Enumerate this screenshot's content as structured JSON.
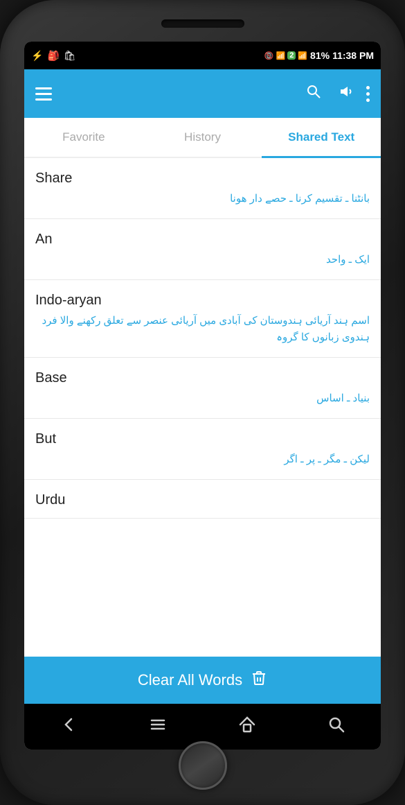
{
  "status_bar": {
    "time": "11:38 PM",
    "battery": "81%",
    "icons_left": [
      "⚡",
      "🎒",
      "🛍"
    ]
  },
  "top_bar": {
    "menu_icon": "☰",
    "search_icon": "🔍",
    "volume_icon": "🔊",
    "more_icon": "⋮"
  },
  "tabs": [
    {
      "id": "favorite",
      "label": "Favorite",
      "active": false
    },
    {
      "id": "history",
      "label": "History",
      "active": false
    },
    {
      "id": "shared-text",
      "label": "Shared Text",
      "active": true
    }
  ],
  "words": [
    {
      "english": "Share",
      "urdu": "بانٹنا ـ تقسیم کرنا ـ حصے دار ھونا"
    },
    {
      "english": "An",
      "urdu": "ایک ـ واحد"
    },
    {
      "english": "Indo-aryan",
      "urdu": "اسم  ہند آریائی ہندوستان کی آبادی میں آریائی عنصر سے تعلق رکھنے والا فرد  ہندوی زبانوں کا گروہ"
    },
    {
      "english": "Base",
      "urdu": "بنیاد ـ اساس"
    },
    {
      "english": "But",
      "urdu": "لیکن ـ مگر ـ پر ـ اگر"
    },
    {
      "english": "Urdu",
      "urdu": ""
    }
  ],
  "clear_button": {
    "label": "Clear All Words",
    "icon": "🗑"
  },
  "bottom_nav": {
    "back_icon": "←",
    "menu_icon": "≡",
    "home_icon": "⌂",
    "search_icon": "🔍"
  }
}
